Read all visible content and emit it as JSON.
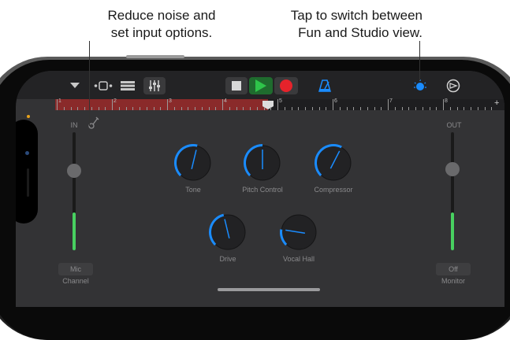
{
  "callouts": {
    "left_line1": "Reduce noise and",
    "left_line2": "set input options.",
    "right_line1": "Tap to switch between",
    "right_line2": "Fun and Studio view."
  },
  "ruler": {
    "bars": [
      "1",
      "2",
      "3",
      "4",
      "5",
      "6",
      "7",
      "8"
    ],
    "add_symbol": "+"
  },
  "input": {
    "label": "IN",
    "level": 0.32,
    "button": "Mic",
    "caption": "Channel"
  },
  "output": {
    "label": "OUT",
    "level": 0.32,
    "button": "Off",
    "caption": "Monitor"
  },
  "knobs": [
    {
      "name": "Tone",
      "value": 0.55
    },
    {
      "name": "Pitch Control",
      "value": 0.5
    },
    {
      "name": "Compressor",
      "value": 0.6
    },
    {
      "name": "Drive",
      "value": 0.45
    },
    {
      "name": "Vocal Hall",
      "value": 0.2
    }
  ],
  "colors": {
    "accent": "#1a8cff",
    "record": "#e6232b",
    "play": "#2ec44a",
    "track_region": "#8a2a2a",
    "meter": "#48d060"
  },
  "icons": [
    "tracks-dropdown-icon",
    "fx-view-icon",
    "tracks-view-icon",
    "mixer-controls-icon",
    "stop-icon",
    "play-icon",
    "record-icon",
    "metronome-icon",
    "view-switch-icon",
    "settings-icon",
    "input-settings-icon"
  ]
}
